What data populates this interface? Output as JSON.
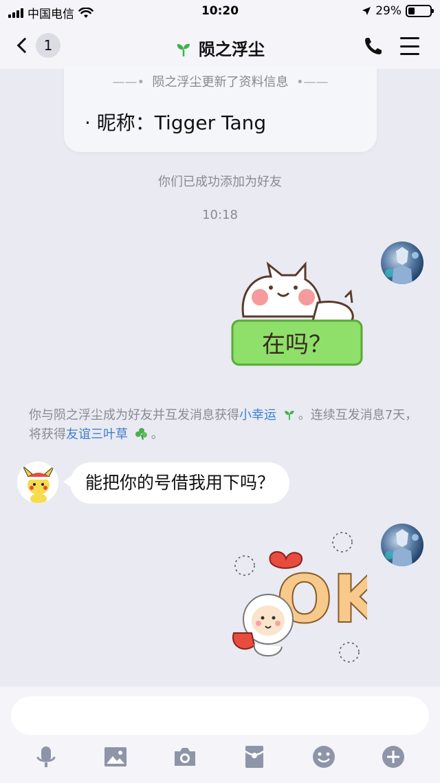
{
  "status_bar": {
    "carrier": "中国电信",
    "time": "10:20",
    "battery_percent": "29%",
    "battery_level": 0.29
  },
  "nav": {
    "unread_count": "1",
    "title": "陨之浮尘"
  },
  "profile_card": {
    "update_text": "陨之浮尘更新了资料信息",
    "field": "· 昵称：Tigger Tang"
  },
  "system": {
    "added_friend": "你们已成功添加为好友",
    "timestamp": "10:18"
  },
  "sticker_1": {
    "caption": "在吗？"
  },
  "luck_note": {
    "part1": "你与陨之浮尘成为好友并互发消息获得",
    "link1": "小幸运",
    "part2": "。连续互发消息7天，将获得",
    "link2": "友谊三叶草",
    "part3": "。"
  },
  "messages": {
    "peer_text": "能把你的号借我用下吗？"
  },
  "sticker_2": {
    "caption": "OK"
  },
  "colors": {
    "background": "#e9eaf2",
    "link": "#3f7fd1",
    "sprout": "#3db34a",
    "sticker_green": "#8ee06a"
  }
}
